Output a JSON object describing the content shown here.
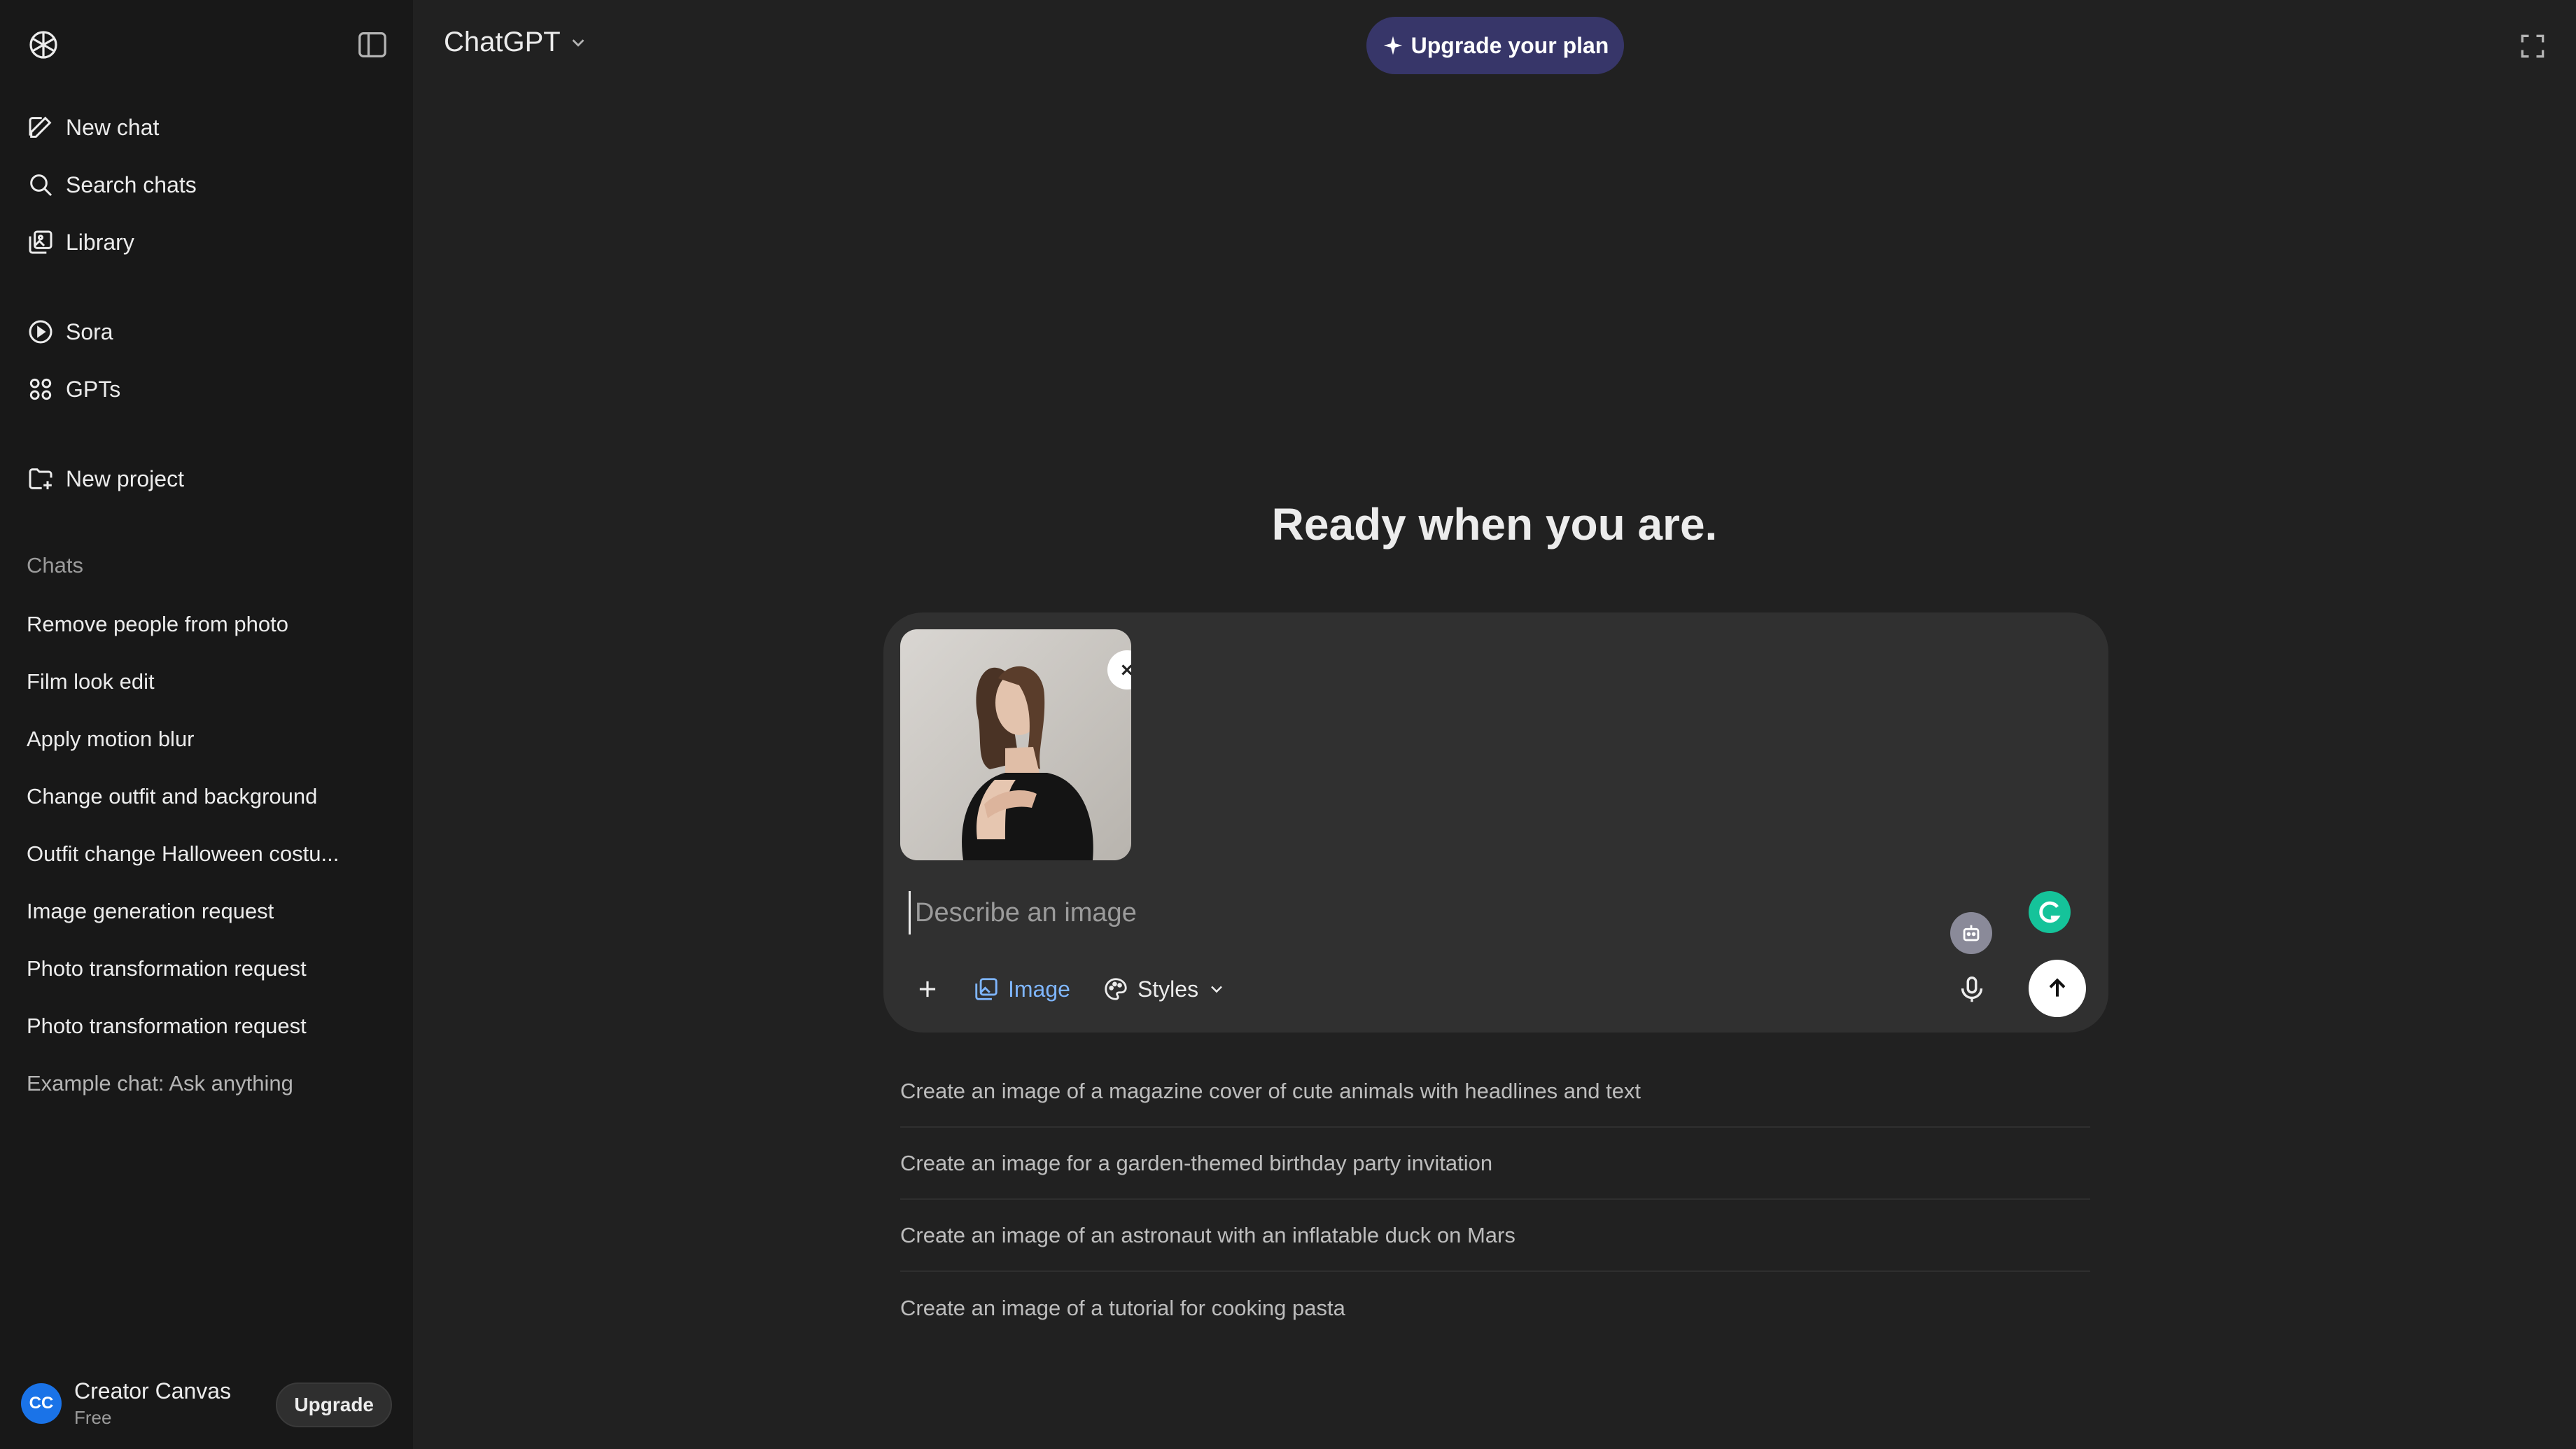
{
  "sidebar": {
    "nav": [
      {
        "label": "New chat",
        "icon": "new-chat-icon"
      },
      {
        "label": "Search chats",
        "icon": "search-icon"
      },
      {
        "label": "Library",
        "icon": "library-icon"
      },
      {
        "label": "Sora",
        "icon": "play-circle-icon"
      },
      {
        "label": "GPTs",
        "icon": "grid-icon"
      },
      {
        "label": "New project",
        "icon": "new-folder-icon"
      }
    ],
    "chats_label": "Chats",
    "chats": [
      "Remove people from photo",
      "Film look edit",
      "Apply motion blur",
      "Change outfit and background",
      "Outfit change Halloween costu...",
      "Image generation request",
      "Photo transformation request",
      "Photo transformation request",
      "Example chat: Ask anything"
    ],
    "account": {
      "initials": "CC",
      "name": "Creator Canvas",
      "plan": "Free",
      "upgrade_label": "Upgrade"
    }
  },
  "header": {
    "model": "ChatGPT",
    "upgrade_label": "Upgrade your plan"
  },
  "main": {
    "heading": "Ready when you are.",
    "composer": {
      "placeholder": "Describe an image",
      "image_label": "Image",
      "styles_label": "Styles"
    },
    "suggestions": [
      "Create an image of a magazine cover of cute animals with headlines and text",
      "Create an image for a garden-themed birthday party invitation",
      "Create an image of an astronaut with an inflatable duck on Mars",
      "Create an image of a tutorial for cooking pasta"
    ]
  },
  "colors": {
    "sidebar_bg": "#181818",
    "main_bg": "#212121",
    "composer_bg": "#303030",
    "upgrade_pill_bg": "#373669",
    "accent_blue": "#7fb6ff"
  }
}
